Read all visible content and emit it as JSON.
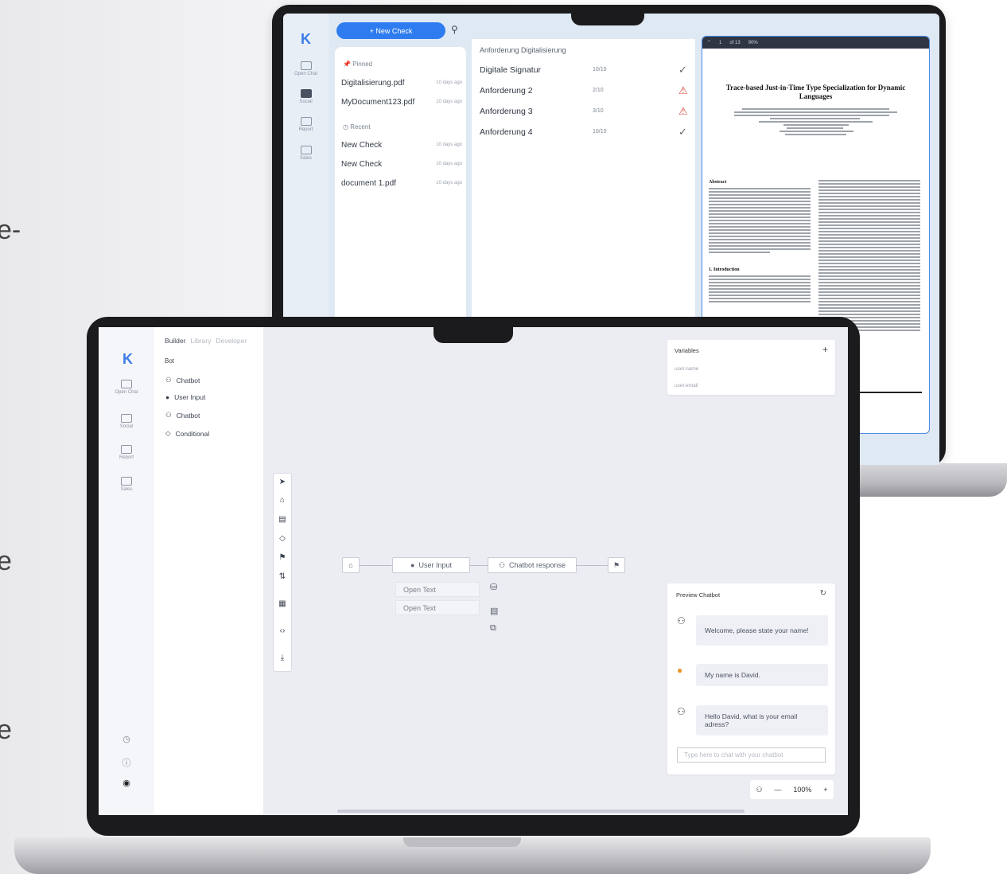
{
  "background_text": {
    "frag1": "e-",
    "frag2": "e",
    "frag3": "e"
  },
  "back_app": {
    "logo": "K",
    "nav": [
      "Open Chat",
      "Social",
      "Report",
      "Sales"
    ],
    "new_check_label": "+ New Check",
    "pinned_header": "Pinned",
    "pinned": [
      {
        "name": "Digitalisierung.pdf",
        "ago": "10 days ago"
      },
      {
        "name": "MyDocument123.pdf",
        "ago": "10 days ago"
      }
    ],
    "recent_header": "Recent",
    "recent": [
      {
        "name": "New Check",
        "ago": "10 days ago"
      },
      {
        "name": "New Check",
        "ago": "10 days ago"
      },
      {
        "name": "document 1.pdf",
        "ago": "10 days ago"
      }
    ],
    "requirements_title": "Anforderung Digitalisierung",
    "requirements": [
      {
        "name": "Digitale Signatur",
        "score": "10/10",
        "status": "ok"
      },
      {
        "name": "Anforderung 2",
        "score": "2/10",
        "status": "warn"
      },
      {
        "name": "Anforderung 3",
        "score": "3/10",
        "status": "warn"
      },
      {
        "name": "Anforderung 4",
        "score": "10/10",
        "status": "ok"
      }
    ],
    "pdf": {
      "page": "1",
      "of": "of 13",
      "zoom": "90%",
      "title": "Trace-based Just-in-Time Type Specialization for Dynamic Languages",
      "section_abstract": "Abstract",
      "section_intro": "1. Introduction"
    }
  },
  "front_app": {
    "logo": "K",
    "nav": [
      "Open Chat",
      "Social",
      "Report",
      "Sales"
    ],
    "tabs": [
      "Builder",
      "Library",
      "Developer"
    ],
    "section": "Bot",
    "items": [
      "Chatbot",
      "User Input",
      "Chatbot",
      "Conditional"
    ],
    "flow": {
      "user_input": "User Input",
      "chatbot_response": "Chatbot response",
      "options": [
        "Open Text",
        "Open Text"
      ]
    },
    "variables": {
      "title": "Variables",
      "items": [
        "user.name",
        "user.email"
      ]
    },
    "preview": {
      "title": "Preview Chatbot",
      "messages": [
        {
          "role": "bot",
          "text": "Welcome, please state your name!"
        },
        {
          "role": "user",
          "text": "My name is David."
        },
        {
          "role": "bot",
          "text": "Hello David, what is your email adress?"
        }
      ],
      "placeholder": "Type here to chat with your chatbot"
    },
    "zoom": "100%",
    "colors": {
      "accent": "#2f7cf0",
      "warning": "#d9463c",
      "user_avatar": "#e9962a"
    }
  }
}
